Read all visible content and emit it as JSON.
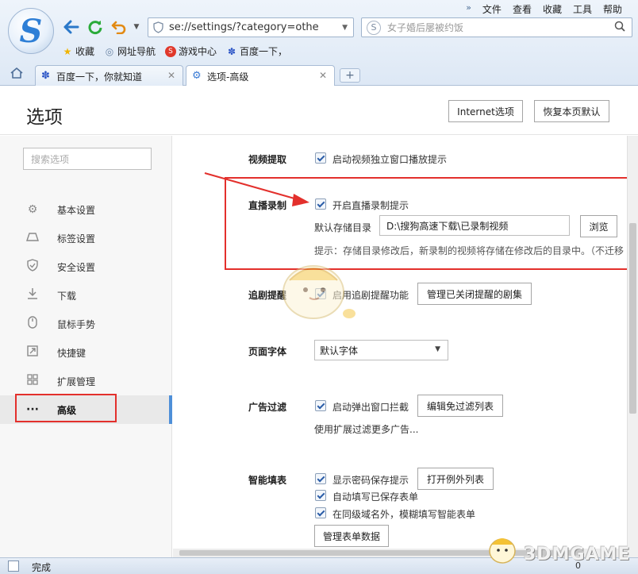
{
  "browser": {
    "logo_letter": "S",
    "menu": [
      "文件",
      "查看",
      "收藏",
      "工具",
      "帮助"
    ],
    "menu_overflow": "»",
    "address": "se://settings/?category=othe",
    "search_placeholder": "女子婚后屡被约饭",
    "favorites": [
      {
        "label": "收藏",
        "icon": "star-icon"
      },
      {
        "label": "网址导航",
        "icon": "globe-icon"
      },
      {
        "label": "游戏中心",
        "icon": "game-icon"
      },
      {
        "label": "百度一下，",
        "icon": "baidu-paw-icon"
      }
    ],
    "tabs": [
      {
        "label": "百度一下，你就知道",
        "icon": "baidu-paw-icon",
        "active": false
      },
      {
        "label": "选项-高级",
        "icon": "gear-icon",
        "active": true
      }
    ],
    "new_tab": "+"
  },
  "page": {
    "title": "选项",
    "internet_options_button": "Internet选项",
    "restore_defaults_button": "恢复本页默认"
  },
  "sidebar": {
    "search_placeholder": "搜索选项",
    "items": [
      {
        "label": "基本设置",
        "icon": "gear-icon"
      },
      {
        "label": "标签设置",
        "icon": "tab-icon"
      },
      {
        "label": "安全设置",
        "icon": "shield-icon"
      },
      {
        "label": "下载",
        "icon": "download-icon"
      },
      {
        "label": "鼠标手势",
        "icon": "mouse-icon"
      },
      {
        "label": "快捷键",
        "icon": "shortcut-icon"
      },
      {
        "label": "扩展管理",
        "icon": "extensions-icon"
      },
      {
        "label": "高级",
        "icon": "more-icon",
        "active": true
      }
    ]
  },
  "settings": {
    "video": {
      "label": "视频提取",
      "checkbox": "启动视频独立窗口播放提示"
    },
    "live": {
      "label": "直播录制",
      "checkbox": "开启直播录制提示",
      "dir_label": "默认存储目录",
      "dir_value": "D:\\搜狗高速下载\\已录制视频",
      "browse": "浏览",
      "hint": "提示：存储目录修改后，新录制的视频将存储在修改后的目录中。（不迁移"
    },
    "drama": {
      "label": "追剧提醒",
      "checkbox": "启用追剧提醒功能",
      "button": "管理已关闭提醒的剧集"
    },
    "font": {
      "label": "页面字体",
      "value": "默认字体"
    },
    "adfilter": {
      "label": "广告过滤",
      "checkbox": "启动弹出窗口拦截",
      "button": "编辑免过滤列表",
      "hint": "使用扩展过滤更多广告..."
    },
    "autofill": {
      "label": "智能填表",
      "checkbox1": "显示密码保存提示",
      "button1": "打开例外列表",
      "checkbox2": "自动填写已保存表单",
      "checkbox3": "在同级域名外，模糊填写智能表单",
      "button2": "管理表单数据"
    }
  },
  "status": {
    "text": "完成",
    "zoom": "0"
  },
  "watermark": "3DMGAME",
  "colors": {
    "accent": "#4e8fd8",
    "annotation": "#e3302c",
    "checkbox_tick": "#2b5da8"
  }
}
